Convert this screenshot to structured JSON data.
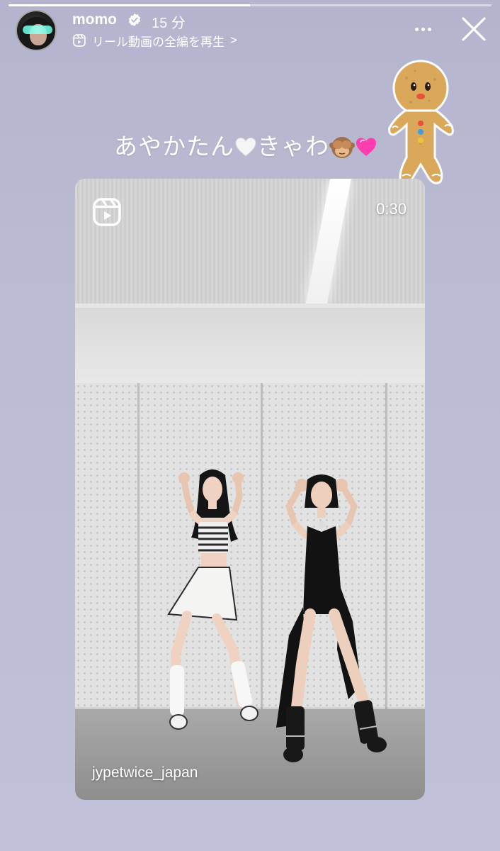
{
  "story": {
    "progress_fraction": 0.5
  },
  "header": {
    "username": "momo",
    "time_ago": "15 分",
    "reel_link_label": "リール動画の全編を再生",
    "reel_link_chevron": ">",
    "verified_icon": "verified-badge-icon",
    "more_icon": "more-dots-icon",
    "close_icon": "close-icon"
  },
  "caption": {
    "part1": "あやかたん",
    "part2": "きゃわ",
    "emoji_1": "white-heart",
    "emoji_2": "see-no-evil-monkey",
    "emoji_3": "pink-heart"
  },
  "sticker": {
    "name": "gingerbread-man-sticker"
  },
  "reel_card": {
    "duration": "0:30",
    "account": "jypetwice_japan",
    "icon": "reels-icon"
  },
  "colors": {
    "background": "#bcbcd4",
    "pink_heart": "#ff3db0",
    "sticker_cookie": "#d9a85a"
  }
}
